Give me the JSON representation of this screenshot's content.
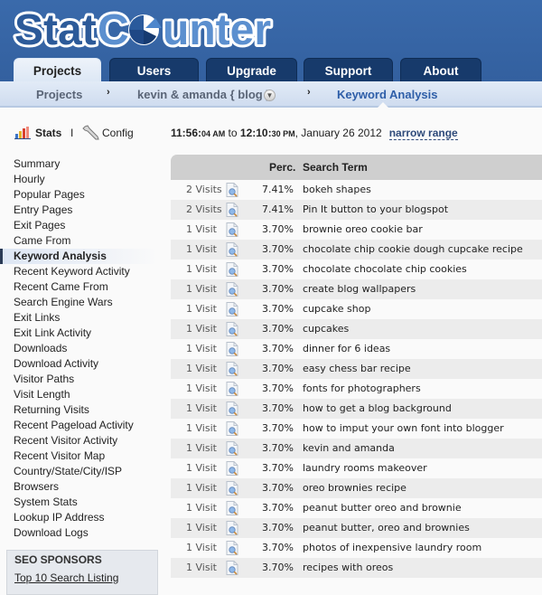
{
  "brand": {
    "name_part1": "Stat",
    "name_part2": "C",
    "name_part3": "unter",
    "colors": {
      "header_bg": "#3465a4",
      "tab_dark": "#173a6b",
      "accent": "#2e5ea8"
    }
  },
  "tabs": [
    {
      "label": "Projects",
      "active": true
    },
    {
      "label": "Users",
      "active": false
    },
    {
      "label": "Upgrade",
      "active": false
    },
    {
      "label": "Support",
      "active": false
    },
    {
      "label": "About",
      "active": false
    }
  ],
  "breadcrumb": {
    "items": [
      "Projects",
      "kevin & amanda { blog }",
      "Keyword Analysis"
    ],
    "separator": "›",
    "dropdown_icon": "chevron-down-circle"
  },
  "sidebar": {
    "stats_label": "Stats",
    "pipe": "I",
    "config_label": "Config",
    "items": [
      {
        "label": "Summary"
      },
      {
        "label": "Hourly"
      },
      {
        "label": "Popular Pages"
      },
      {
        "label": "Entry Pages"
      },
      {
        "label": "Exit Pages"
      },
      {
        "label": "Came From"
      },
      {
        "label": "Keyword Analysis",
        "active": true
      },
      {
        "label": "Recent Keyword Activity"
      },
      {
        "label": "Recent Came From"
      },
      {
        "label": "Search Engine Wars"
      },
      {
        "label": "Exit Links"
      },
      {
        "label": "Exit Link Activity"
      },
      {
        "label": "Downloads"
      },
      {
        "label": "Download Activity"
      },
      {
        "label": "Visitor Paths"
      },
      {
        "label": "Visit Length"
      },
      {
        "label": "Returning Visits"
      },
      {
        "label": "Recent Pageload Activity"
      },
      {
        "label": "Recent Visitor Activity"
      },
      {
        "label": "Recent Visitor Map"
      },
      {
        "label": "Country/State/City/ISP"
      },
      {
        "label": "Browsers"
      },
      {
        "label": "System Stats"
      },
      {
        "label": "Lookup IP Address"
      },
      {
        "label": "Download Logs"
      }
    ],
    "sponsors": {
      "title": "SEO SPONSORS",
      "link": "Top 10 Search Listing"
    }
  },
  "range": {
    "start_hm": "11:56:",
    "start_s": "04 AM",
    "to": " to ",
    "end_hm": "12:10:",
    "end_s": "30 PM",
    "date": ", January 26 2012",
    "narrow": "narrow range"
  },
  "table": {
    "headers": {
      "perc": "Perc.",
      "term": "Search Term"
    },
    "rows": [
      {
        "visits": "2 Visits",
        "perc": "7.41%",
        "term": "bokeh shapes"
      },
      {
        "visits": "2 Visits",
        "perc": "7.41%",
        "term": "Pin It button to your blogspot"
      },
      {
        "visits": "1 Visit",
        "perc": "3.70%",
        "term": "brownie oreo cookie bar"
      },
      {
        "visits": "1 Visit",
        "perc": "3.70%",
        "term": "chocolate chip cookie dough cupcake recipe"
      },
      {
        "visits": "1 Visit",
        "perc": "3.70%",
        "term": "chocolate chocolate chip cookies"
      },
      {
        "visits": "1 Visit",
        "perc": "3.70%",
        "term": "create blog wallpapers"
      },
      {
        "visits": "1 Visit",
        "perc": "3.70%",
        "term": "cupcake shop"
      },
      {
        "visits": "1 Visit",
        "perc": "3.70%",
        "term": "cupcakes"
      },
      {
        "visits": "1 Visit",
        "perc": "3.70%",
        "term": "dinner for 6 ideas"
      },
      {
        "visits": "1 Visit",
        "perc": "3.70%",
        "term": "easy chess bar recipe"
      },
      {
        "visits": "1 Visit",
        "perc": "3.70%",
        "term": "fonts for photographers"
      },
      {
        "visits": "1 Visit",
        "perc": "3.70%",
        "term": "how to get a blog background"
      },
      {
        "visits": "1 Visit",
        "perc": "3.70%",
        "term": "how to imput your own font into blogger"
      },
      {
        "visits": "1 Visit",
        "perc": "3.70%",
        "term": "kevin and amanda"
      },
      {
        "visits": "1 Visit",
        "perc": "3.70%",
        "term": "laundry rooms makeover"
      },
      {
        "visits": "1 Visit",
        "perc": "3.70%",
        "term": "oreo brownies recipe"
      },
      {
        "visits": "1 Visit",
        "perc": "3.70%",
        "term": "peanut butter oreo and brownie"
      },
      {
        "visits": "1 Visit",
        "perc": "3.70%",
        "term": "peanut butter, oreo and brownies"
      },
      {
        "visits": "1 Visit",
        "perc": "3.70%",
        "term": "photos of inexpensive laundry room"
      },
      {
        "visits": "1 Visit",
        "perc": "3.70%",
        "term": "recipes with oreos"
      }
    ]
  }
}
